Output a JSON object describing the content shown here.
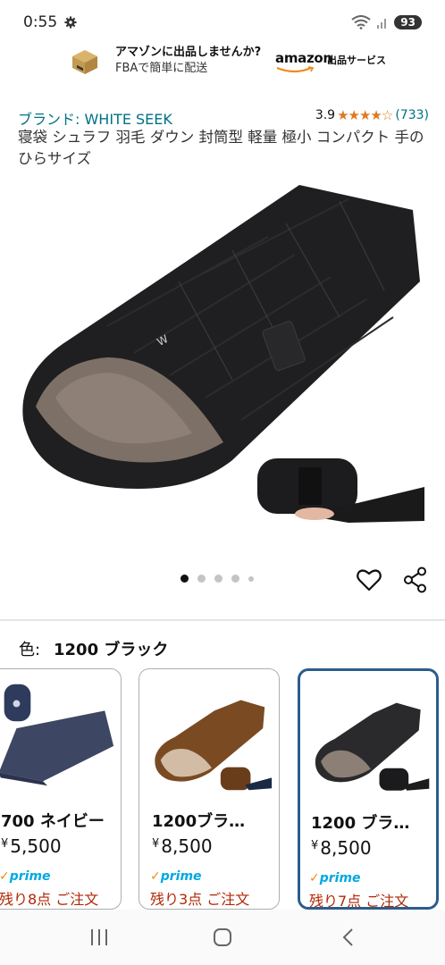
{
  "status_bar": {
    "time": "0:55",
    "battery": "93"
  },
  "ad": {
    "line1": "アマゾンに出品しませんか?",
    "line2": "FBAで簡単に配送",
    "brand_logo": "amazon",
    "brand_service": "出品サービス"
  },
  "product": {
    "brand": "ブランド: WHITE SEEK",
    "rating_value": "3.9",
    "rating_stars": "★★★★☆",
    "rating_count": "(733)",
    "title": "寝袋 シュラフ 羽毛 ダウン 封筒型 軽量 極小 コンパクト 手のひらサイズ"
  },
  "carousel": {
    "total": 5,
    "active_index": 0
  },
  "variation": {
    "label": "色:",
    "selected": "1200 ブラック",
    "options": [
      {
        "name": "700 ネイビー",
        "yen": "¥",
        "price": "5,500",
        "prime": "prime",
        "stock": "残り8点 ご注文",
        "color": "#3d4663"
      },
      {
        "name": "1200ブラ…",
        "yen": "¥",
        "price": "8,500",
        "prime": "prime",
        "stock": "残り3点 ご注文",
        "color": "#7a4a22"
      },
      {
        "name": "1200 ブラ…",
        "yen": "¥",
        "price": "8,500",
        "prime": "prime",
        "stock": "残り7点 ご注文",
        "color": "#2a2a2c"
      }
    ]
  },
  "colors": {
    "link": "#007185",
    "star": "#de7921",
    "stock": "#b12704",
    "selected_border": "#2b5d8c"
  }
}
